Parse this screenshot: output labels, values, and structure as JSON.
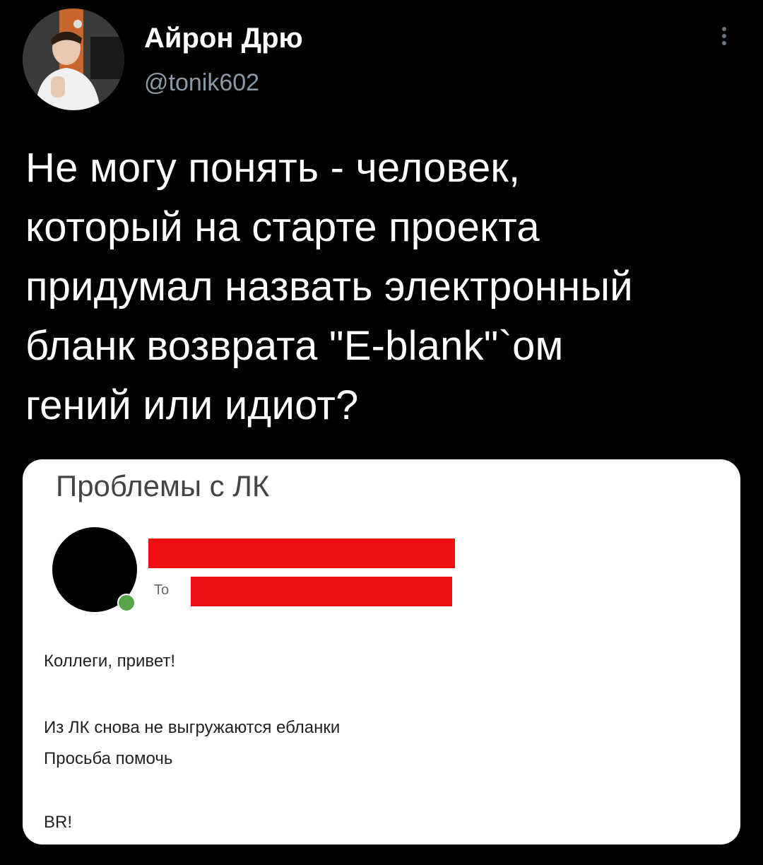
{
  "tweet": {
    "author": {
      "display_name": "Айрон Дрю",
      "handle": "@tonik602",
      "avatar_icon": "user-photo"
    },
    "more_icon": "more-vertical-icon",
    "text_lines": [
      "Не могу понять - человек,",
      "который на старте проекта",
      "придумал назвать электронный",
      "бланк возврата \"E-blank\"`ом",
      "гений или идиот?"
    ]
  },
  "attached_image": {
    "subject": "Проблемы с ЛК",
    "to_label": "To",
    "redaction_color": "#ee1111",
    "presence_color": "#57a64a",
    "body": {
      "greeting": "Коллеги, привет!",
      "line1": "Из ЛК снова не выгружаются ебланки",
      "line2": "Просьба помочь",
      "signoff": "BR!"
    }
  },
  "colors": {
    "background": "#000000",
    "text": "#ffffff",
    "secondary_text": "#8b98a5"
  }
}
